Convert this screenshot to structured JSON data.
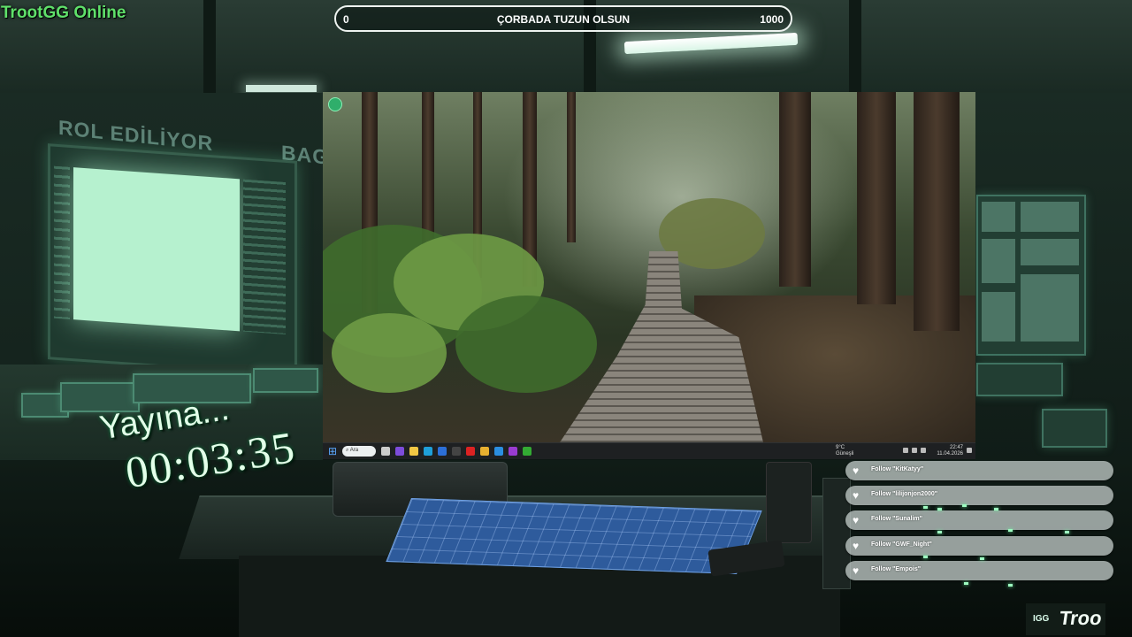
{
  "brand": {
    "title": "TrootGG Online"
  },
  "goal": {
    "min": "0",
    "title": "ÇORBADA TUZUN OLSUN",
    "max": "1000",
    "progress": 0
  },
  "wall_text": {
    "left": "ROL EDİLİYOR",
    "right": "BAG"
  },
  "stream": {
    "status": "Yayına...",
    "timer": "00:03:35"
  },
  "desktop": {
    "taskbar": {
      "search_placeholder": "Ara",
      "weather_temp": "9°C",
      "weather_desc": "Güneşli",
      "time": "22:47",
      "date": "11.04.2026"
    }
  },
  "follows": [
    {
      "text": "Follow \"KitKatyy\""
    },
    {
      "text": "Follow \"lilijonjon2000\""
    },
    {
      "text": "Follow \"Sunalim\""
    },
    {
      "text": "Follow \"GWF_Night\""
    },
    {
      "text": "Follow \"Empois\""
    }
  ],
  "logo": {
    "small": "IGG",
    "big": "Troo"
  },
  "colors": {
    "brand_green": "#5fe06a",
    "timer_text": "#e3ffe9",
    "follow_bg": "#bec6c4"
  }
}
